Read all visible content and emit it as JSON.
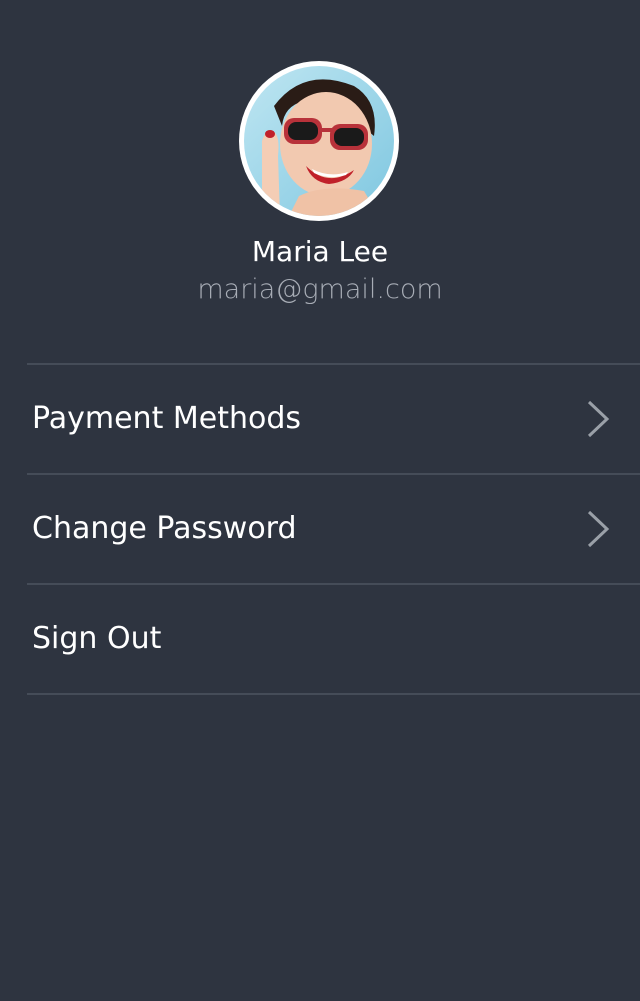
{
  "profile": {
    "name": "Maria Lee",
    "email": "maria@gmail.com",
    "avatar_icon": "profile-photo"
  },
  "menu": {
    "items": [
      {
        "label": "Payment Methods",
        "icon": "chevron-right-icon"
      },
      {
        "label": "Change Password",
        "icon": "chevron-right-icon"
      },
      {
        "label": "Sign Out"
      }
    ]
  },
  "colors": {
    "background": "#2e3440",
    "divider": "#454c58",
    "text_primary": "#ffffff",
    "text_secondary": "#a8adb6",
    "chevron": "#9aa0a8"
  }
}
